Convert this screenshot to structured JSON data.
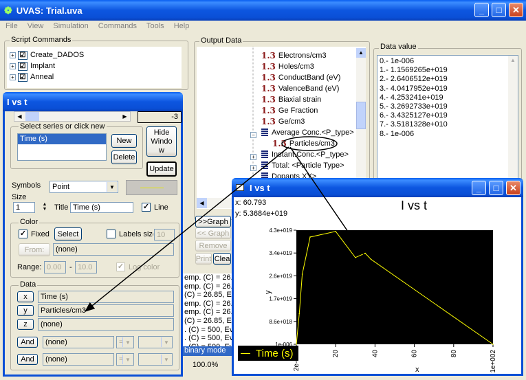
{
  "main": {
    "title": "UVAS: Trial.uva",
    "menu": [
      "File",
      "View",
      "Simulation",
      "Commands",
      "Tools",
      "Help"
    ]
  },
  "script_commands": {
    "label": "Script Commands",
    "items": [
      "Create_DADOS",
      "Implant",
      "Anneal"
    ]
  },
  "output_data": {
    "label": "Output Data",
    "items": [
      {
        "type": "r13",
        "label": "Electrons/cm3"
      },
      {
        "type": "r13",
        "label": "Holes/cm3"
      },
      {
        "type": "r13",
        "label": "ConductBand (eV)"
      },
      {
        "type": "r13",
        "label": "ValenceBand (eV)"
      },
      {
        "type": "r13",
        "label": "Biaxial strain"
      },
      {
        "type": "r13",
        "label": "Ge Fraction"
      },
      {
        "type": "r13",
        "label": "Ge/cm3"
      },
      {
        "type": "list",
        "label": "Average Conc.<P_type>"
      },
      {
        "type": "r13",
        "label": "Particles/cm3"
      },
      {
        "type": "list",
        "label": "Instant.Conc.<P_type>"
      },
      {
        "type": "list",
        "label": "Total: <Particle Type>"
      },
      {
        "type": "list",
        "label": "Dopants XY>"
      }
    ],
    "graph_buttons": [
      ">>Graph",
      "<< Graph",
      "Remove",
      "Print",
      "Clea"
    ]
  },
  "data_value": {
    "label": "Data value",
    "items": [
      "0.- 1e-006",
      "1.- 1.1569265e+019",
      "2.- 2.6406512e+019",
      "3.- 4.0417952e+019",
      "4.- 4.253241e+019",
      "5.- 3.2692733e+019",
      "6.- 3.4325127e+019",
      "7.- 3.5181328e+010",
      "8.- 1e-006"
    ]
  },
  "log_lines": [
    "emp. (C) = 26.8",
    "emp. (C) = 26.8",
    "(C) = 26.85, Ev",
    "emp. (C) = 26.8",
    "emp. (C) = 26.8",
    "(C) = 26.85, Ev",
    ". (C) = 500, Ev",
    ". (C) = 500, Ev",
    ". (C) = 500, Ev"
  ],
  "status": {
    "mode": "binary mode",
    "zoom": "100.0%"
  },
  "series_dialog": {
    "title": "I vs t",
    "scroll_value": "-3",
    "select_label": "Select series or click new",
    "series": [
      "Time (s)"
    ],
    "new_btn": "New",
    "delete_btn": "Delete",
    "hide_btn": "Hide Windo w",
    "update_btn": "Update",
    "symbols_label": "Symbols",
    "symbol_value": "Point",
    "size_label": "Size",
    "size_value": "1",
    "title_label": "Title",
    "title_value": "Time (s)",
    "line_label": "Line",
    "color_label": "Color",
    "fixed_label": "Fixed",
    "select_btn": "Select",
    "labels_size_label": "Labels size",
    "labels_size_value": "10",
    "from_btn": "From:",
    "from_value": "(none)",
    "range_label": "Range:",
    "range_min": "0.00",
    "range_sep": "-",
    "range_max": "10.0",
    "log_color_label": "Log color",
    "data_label": "Data",
    "x_btn": "x",
    "x_value": "Time (s)",
    "y_btn": "y",
    "y_value": "Particles/cm3",
    "z_btn": "z",
    "z_value": "(none)",
    "and_btn": "And",
    "and1_value": "(none)",
    "and1_op": "=",
    "and2_value": "(none)",
    "and2_op": "="
  },
  "plot_window": {
    "title": "I vs t",
    "readout_x": "x: 60.793",
    "readout_y": "y: 5.3684e+019",
    "legend_label": "Time (s)"
  },
  "chart_data": {
    "type": "line",
    "title": "I vs t",
    "xlabel": "x",
    "ylabel": "y",
    "x_ticks": [
      "2e-008",
      "20",
      "40",
      "60",
      "80",
      "1e+002"
    ],
    "y_ticks": [
      "1e-006",
      "8.6e+018",
      "1.7e+019",
      "2.6e+019",
      "3.4e+019",
      "4.3e+019"
    ],
    "xlim": [
      0,
      100
    ],
    "ylim": [
      0,
      4.3e+19
    ],
    "grid": false,
    "series": [
      {
        "name": "Time (s)",
        "color": "#ffff00",
        "x": [
          0,
          1.5,
          3,
          7,
          20,
          30,
          35,
          38,
          100
        ],
        "y": [
          1e-06,
          1.1569265e+19,
          2.6406512e+19,
          4.0417952e+19,
          4.253241e+19,
          3.2692733e+19,
          3.4325127e+19,
          3.2e+19,
          1e-06
        ]
      }
    ]
  },
  "colors": {
    "xp_blue": "#0a4fd6",
    "plot_bg": "#000000",
    "series": "#ffff00",
    "r13": "#8b1a1a"
  }
}
